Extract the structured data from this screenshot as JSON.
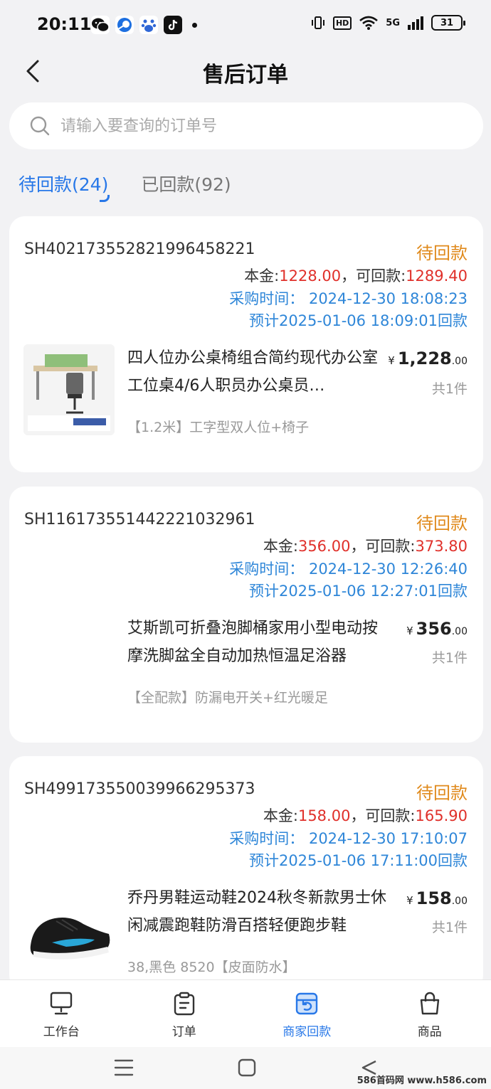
{
  "status_bar": {
    "time": "20:11",
    "network": "5G",
    "battery": "31"
  },
  "header": {
    "title": "售后订单"
  },
  "search": {
    "placeholder": "请输入要查询的订单号"
  },
  "tabs": [
    {
      "label": "待回款(24)",
      "active": true
    },
    {
      "label": "已回款(92)",
      "active": false
    }
  ],
  "orders": [
    {
      "order_no": "SH402173552821996458221",
      "status": "待回款",
      "principal_label": "本金:",
      "principal": "1228.00",
      "refundable_label": "，可回款:",
      "refundable": "1289.40",
      "purchase_time": "采购时间：  2024-12-30 18:08:23",
      "expected": "预计2025-01-06 18:09:01回款",
      "product_name": "四人位办公桌椅组合简约现代办公室工位桌4/6人职员办公桌员…",
      "price_int": "1,228",
      "price_dec": ".00",
      "qty": "共1件",
      "spec": "【1.2米】工字型双人位+椅子"
    },
    {
      "order_no": "SH116173551442221032961",
      "status": "待回款",
      "principal_label": "本金:",
      "principal": "356.00",
      "refundable_label": "，可回款:",
      "refundable": "373.80",
      "purchase_time": "采购时间：  2024-12-30 12:26:40",
      "expected": "预计2025-01-06 12:27:01回款",
      "product_name": "艾斯凯可折叠泡脚桶家用小型电动按摩洗脚盆全自动加热恒温足浴器",
      "price_int": "356",
      "price_dec": ".00",
      "qty": "共1件",
      "spec": "【全配款】防漏电开关+红光暖足"
    },
    {
      "order_no": "SH499173550039966295373",
      "status": "待回款",
      "principal_label": "本金:",
      "principal": "158.00",
      "refundable_label": "，可回款:",
      "refundable": "165.90",
      "purchase_time": "采购时间：  2024-12-30 17:10:07",
      "expected": "预计2025-01-06 17:11:00回款",
      "product_name": "乔丹男鞋运动鞋2024秋冬新款男士休闲减震跑鞋防滑百搭轻便跑步鞋",
      "price_int": "158",
      "price_dec": ".00",
      "qty": "共1件",
      "spec": "38,黑色 8520【皮面防水】"
    }
  ],
  "bottom_tabs": [
    {
      "label": "工作台",
      "icon": "monitor-icon"
    },
    {
      "label": "订单",
      "icon": "clipboard-icon"
    },
    {
      "label": "商家回款",
      "icon": "refund-icon",
      "active": true
    },
    {
      "label": "商品",
      "icon": "bag-icon"
    }
  ],
  "watermark": "586首码网 www.h586.com",
  "colors": {
    "accent": "#2878e8",
    "status": "#e08a1c",
    "money_red": "#e0302a",
    "time_blue": "#2e86d8"
  }
}
